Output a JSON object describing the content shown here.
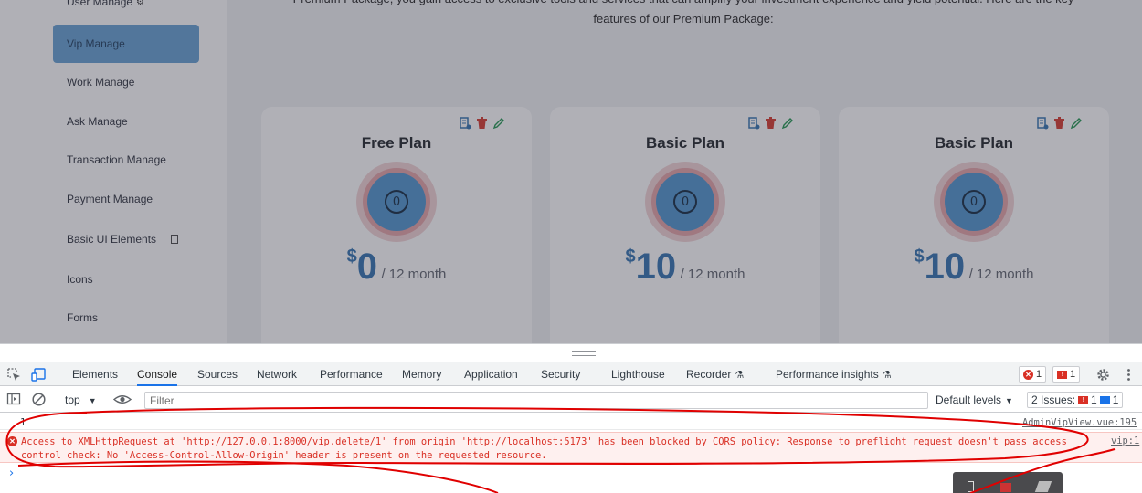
{
  "sidebar": {
    "items": [
      {
        "label": "User Manage",
        "active": false
      },
      {
        "label": "Vip Manage",
        "active": true
      },
      {
        "label": "Work Manage",
        "active": false
      },
      {
        "label": "Ask Manage",
        "active": false
      },
      {
        "label": "Transaction Manage",
        "active": false
      },
      {
        "label": "Payment Manage",
        "active": false
      },
      {
        "label": "Basic UI Elements",
        "active": false
      },
      {
        "label": "Icons",
        "active": false
      },
      {
        "label": "Forms",
        "active": false
      }
    ]
  },
  "intro": {
    "line1": "Premium Package, you gain access to exclusive tools and services that can amplify your investment experience and yield potential. Here are the key",
    "line2": "features of our Premium Package:"
  },
  "plans": [
    {
      "title": "Free Plan",
      "currency": "$",
      "price": "0",
      "period": "/ 12 month"
    },
    {
      "title": "Basic Plan",
      "currency": "$",
      "price": "10",
      "period": "/ 12 month"
    },
    {
      "title": "Basic Plan",
      "currency": "$",
      "price": "10",
      "period": "/ 12 month"
    }
  ],
  "coin_glyph": "0",
  "devtools": {
    "tabs": [
      "Elements",
      "Console",
      "Sources",
      "Network",
      "Performance",
      "Memory",
      "Application",
      "Security",
      "Lighthouse",
      "Recorder",
      "Performance insights"
    ],
    "active_tab": "Console",
    "error_count": "1",
    "warning_count": "1",
    "context": "top",
    "filter_placeholder": "Filter",
    "levels": "Default levels",
    "issues_label": "2 Issues:",
    "issues_error": "1",
    "issues_info": "1",
    "log": {
      "value": "1",
      "source": "AdminVipView.vue:195"
    },
    "error": {
      "pre": "Access to XMLHttpRequest at '",
      "url": "http://127.0.0.1:8000/vip.delete/1",
      "mid": "' from origin '",
      "origin": "http://localhost:5173",
      "post": "' has been blocked by CORS policy: Response to preflight request doesn't pass access control check: No 'Access-Control-Allow-Origin' header is present on the requested resource.",
      "source": "vip:1"
    },
    "prompt": "›"
  },
  "colors": {
    "accent": "#1a73e8",
    "error": "#d93025",
    "annotation": "#e00000",
    "price": "#3f7cb5"
  }
}
